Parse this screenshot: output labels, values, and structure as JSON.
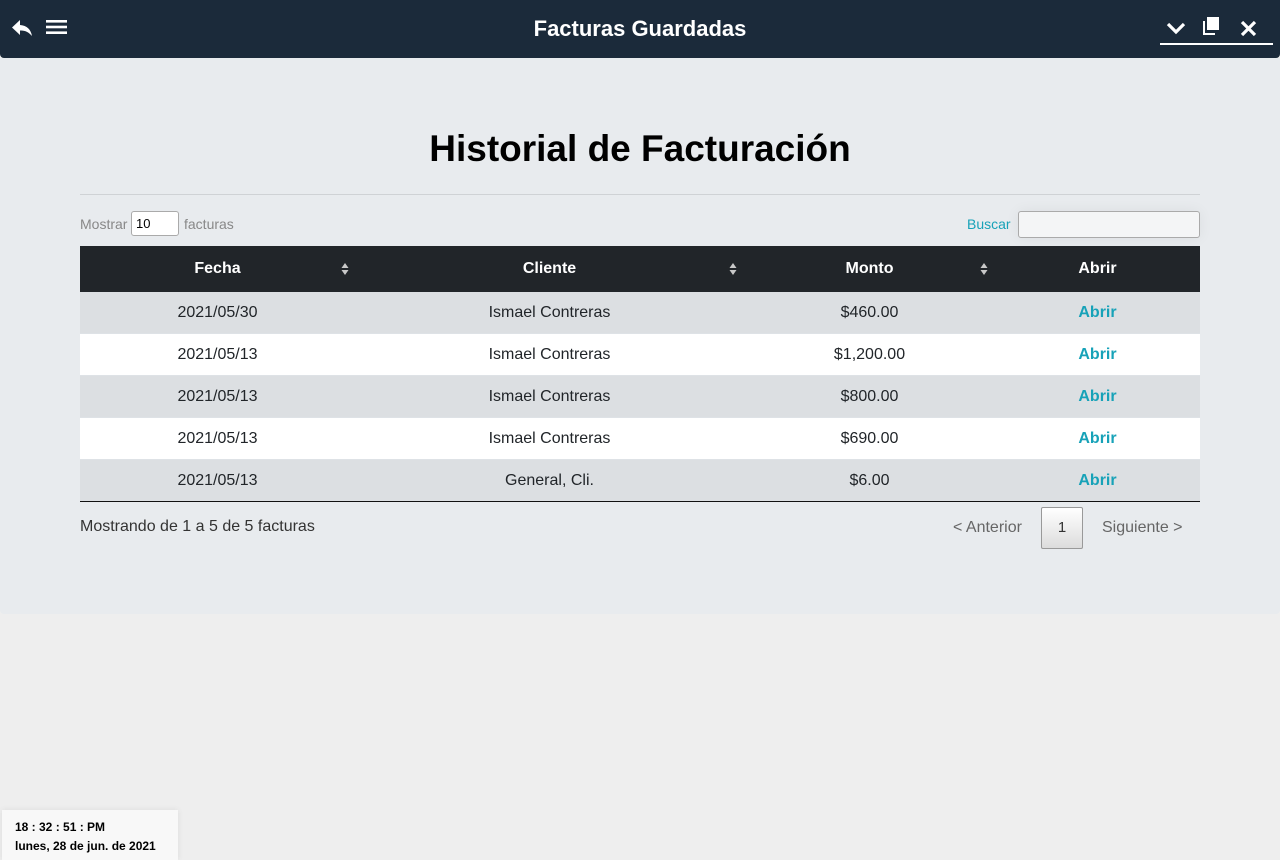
{
  "window": {
    "title": "Facturas Guardadas",
    "icons": [
      "back-arrow-icon",
      "hamburger-menu-icon",
      "chevron-down-icon",
      "restore-window-icon",
      "close-icon"
    ]
  },
  "page": {
    "heading": "Historial de Facturación"
  },
  "controls": {
    "show_label": "Mostrar",
    "show_value": "10",
    "show_suffix": "facturas",
    "search_label": "Buscar",
    "search_value": ""
  },
  "table": {
    "headers": [
      "Fecha",
      "Cliente",
      "Monto",
      "Abrir"
    ],
    "rows": [
      {
        "fecha": "2021/05/30",
        "cliente": "Ismael Contreras",
        "monto": "$460.00",
        "abrir": "Abrir"
      },
      {
        "fecha": "2021/05/13",
        "cliente": "Ismael Contreras",
        "monto": "$1,200.00",
        "abrir": "Abrir"
      },
      {
        "fecha": "2021/05/13",
        "cliente": "Ismael Contreras",
        "monto": "$800.00",
        "abrir": "Abrir"
      },
      {
        "fecha": "2021/05/13",
        "cliente": "Ismael Contreras",
        "monto": "$690.00",
        "abrir": "Abrir"
      },
      {
        "fecha": "2021/05/13",
        "cliente": "General, Cli.",
        "monto": "$6.00",
        "abrir": "Abrir"
      }
    ]
  },
  "footer": {
    "info": "Mostrando de 1 a 5 de 5 facturas",
    "prev": "< Anterior",
    "page": "1",
    "next": "Siguiente >"
  },
  "clock": {
    "time": "18 : 32 : 51 : PM",
    "date": "lunes, 28 de jun. de 2021"
  },
  "colors": {
    "titlebar": "#1b2a3a",
    "table_header": "#212529",
    "accent": "#17a2b8"
  }
}
